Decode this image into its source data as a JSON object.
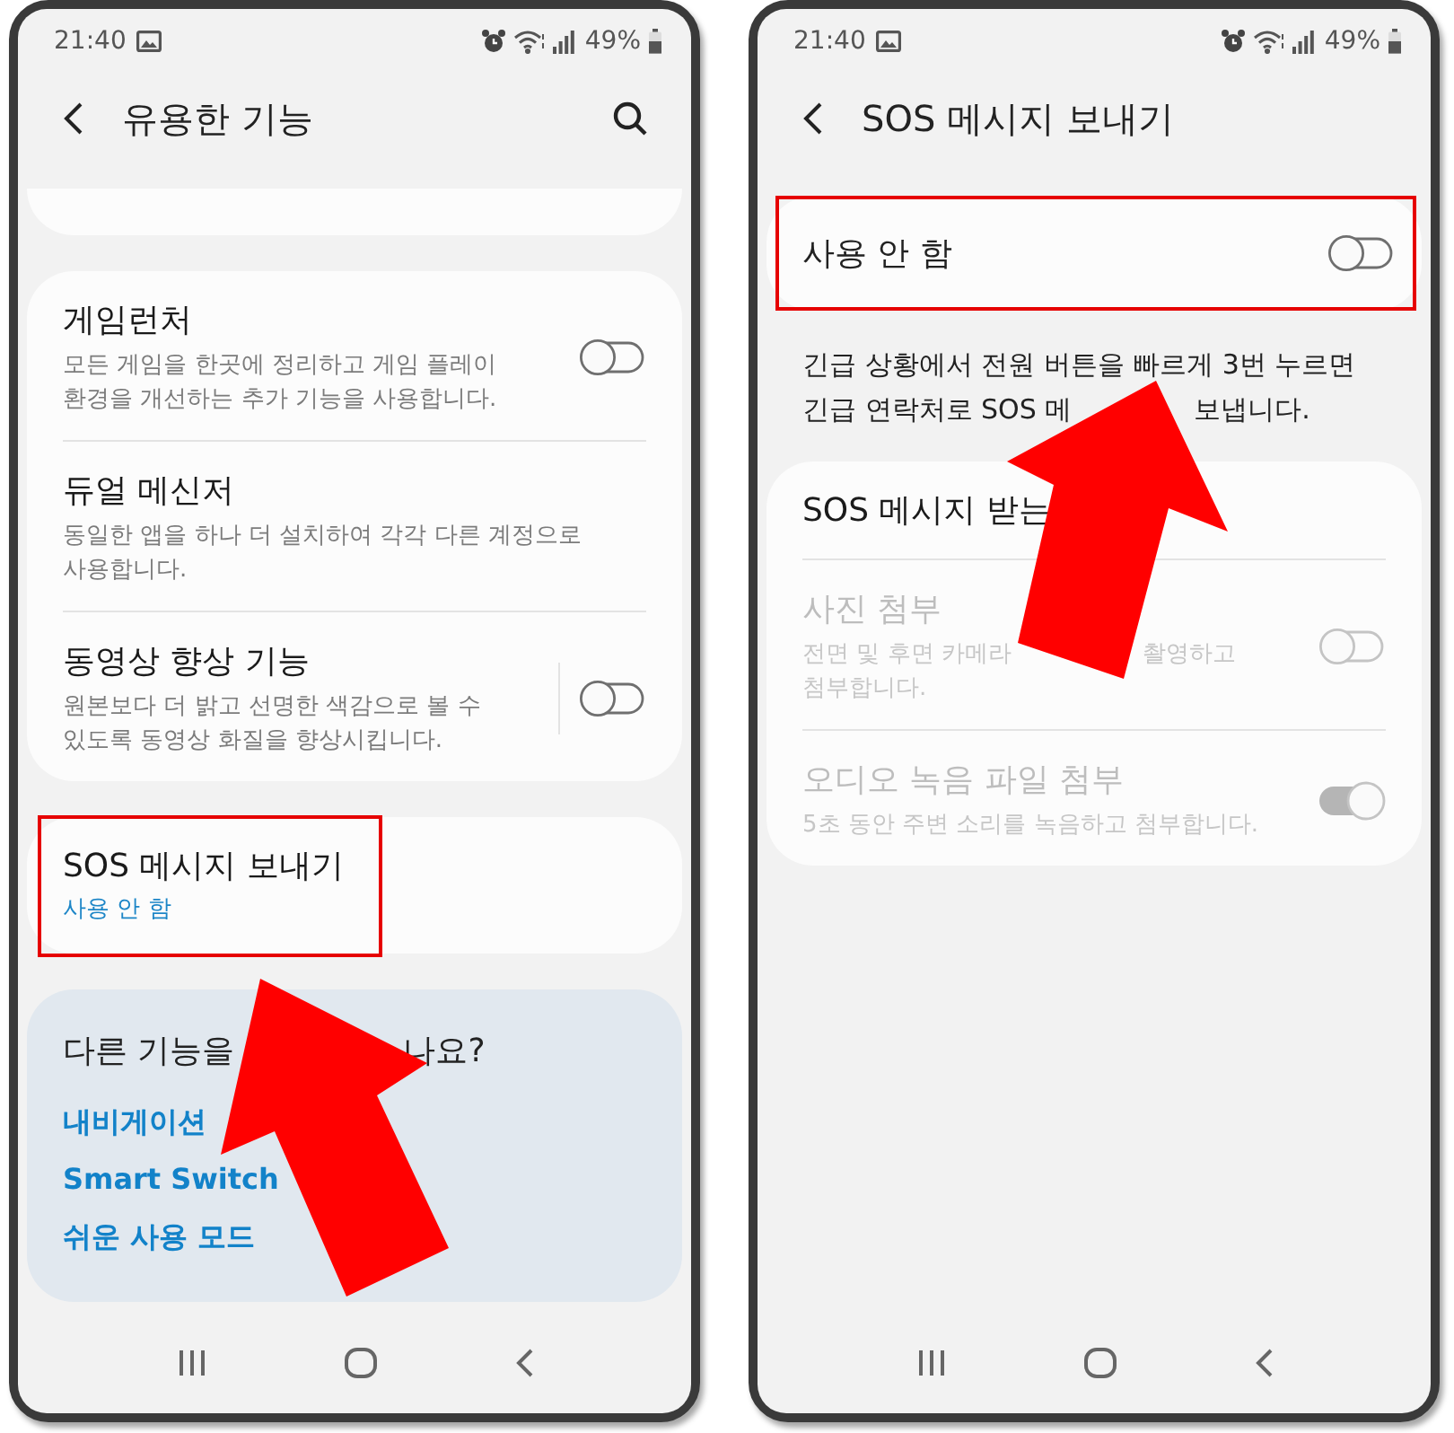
{
  "screens": [
    {
      "status_bar": {
        "time": "21:40",
        "battery": "49%"
      },
      "header": {
        "title": "유용한 기능",
        "search": true
      },
      "sections": [
        {
          "kind": "clipped-card"
        },
        {
          "kind": "card",
          "items": [
            {
              "title": "게임런처",
              "description": [
                "모든 게임을 한곳에 정리하고 게임 플레이",
                "환경을 개선하는 추가 기능을 사용합니다."
              ],
              "toggle": {
                "on": false
              },
              "disabled": false
            },
            {
              "title": "듀얼 메신저",
              "description": [
                "동일한 앱을 하나 더 설치하여 각각 다른 계정으로",
                "사용합니다."
              ],
              "disabled": false
            },
            {
              "title": "동영상 향상 기능",
              "description": [
                "원본보다 더 밝고 선명한 색감으로 볼 수",
                "있도록 동영상 화질을 향상시킵니다."
              ],
              "toggle": {
                "on": false
              },
              "toggle_separator": true,
              "disabled": false
            }
          ]
        },
        {
          "kind": "card",
          "items": [
            {
              "title": "SOS 메시지 보내기",
              "status": "사용 안 함",
              "highlighted": true,
              "disabled": false
            }
          ]
        },
        {
          "kind": "links",
          "heading": [
            "다른 기능을",
            "나요?"
          ],
          "links": [
            "내비게이션",
            "Smart Switch",
            "쉬운 사용 모드"
          ]
        }
      ]
    },
    {
      "status_bar": {
        "time": "21:40",
        "battery": "49%"
      },
      "header": {
        "title": "SOS 메시지 보내기"
      },
      "sections": [
        {
          "kind": "master-switch",
          "label": "사용 안 함",
          "toggle": {
            "on": false
          },
          "highlighted": true
        },
        {
          "kind": "note",
          "lines": [
            "긴급 상황에서 전원 버튼을 빠르게 3번 누르면",
            [
              "긴급 연락처로 SOS 메",
              "보냅니다."
            ]
          ]
        },
        {
          "kind": "card",
          "items": [
            {
              "title": "SOS 메시지 받는",
              "disabled": false
            },
            {
              "title": "사진 첨부",
              "description": [
                [
                  "전면 및 후면 카메라",
                  "촬영하고"
                ],
                "첨부합니다."
              ],
              "toggle": {
                "on": false
              },
              "disabled": true
            },
            {
              "title": "오디오 녹음 파일 첨부",
              "description": [
                "5초 동안 주변 소리를 녹음하고 첨부합니다."
              ],
              "toggle": {
                "on": true
              },
              "disabled": true
            }
          ]
        }
      ]
    }
  ]
}
